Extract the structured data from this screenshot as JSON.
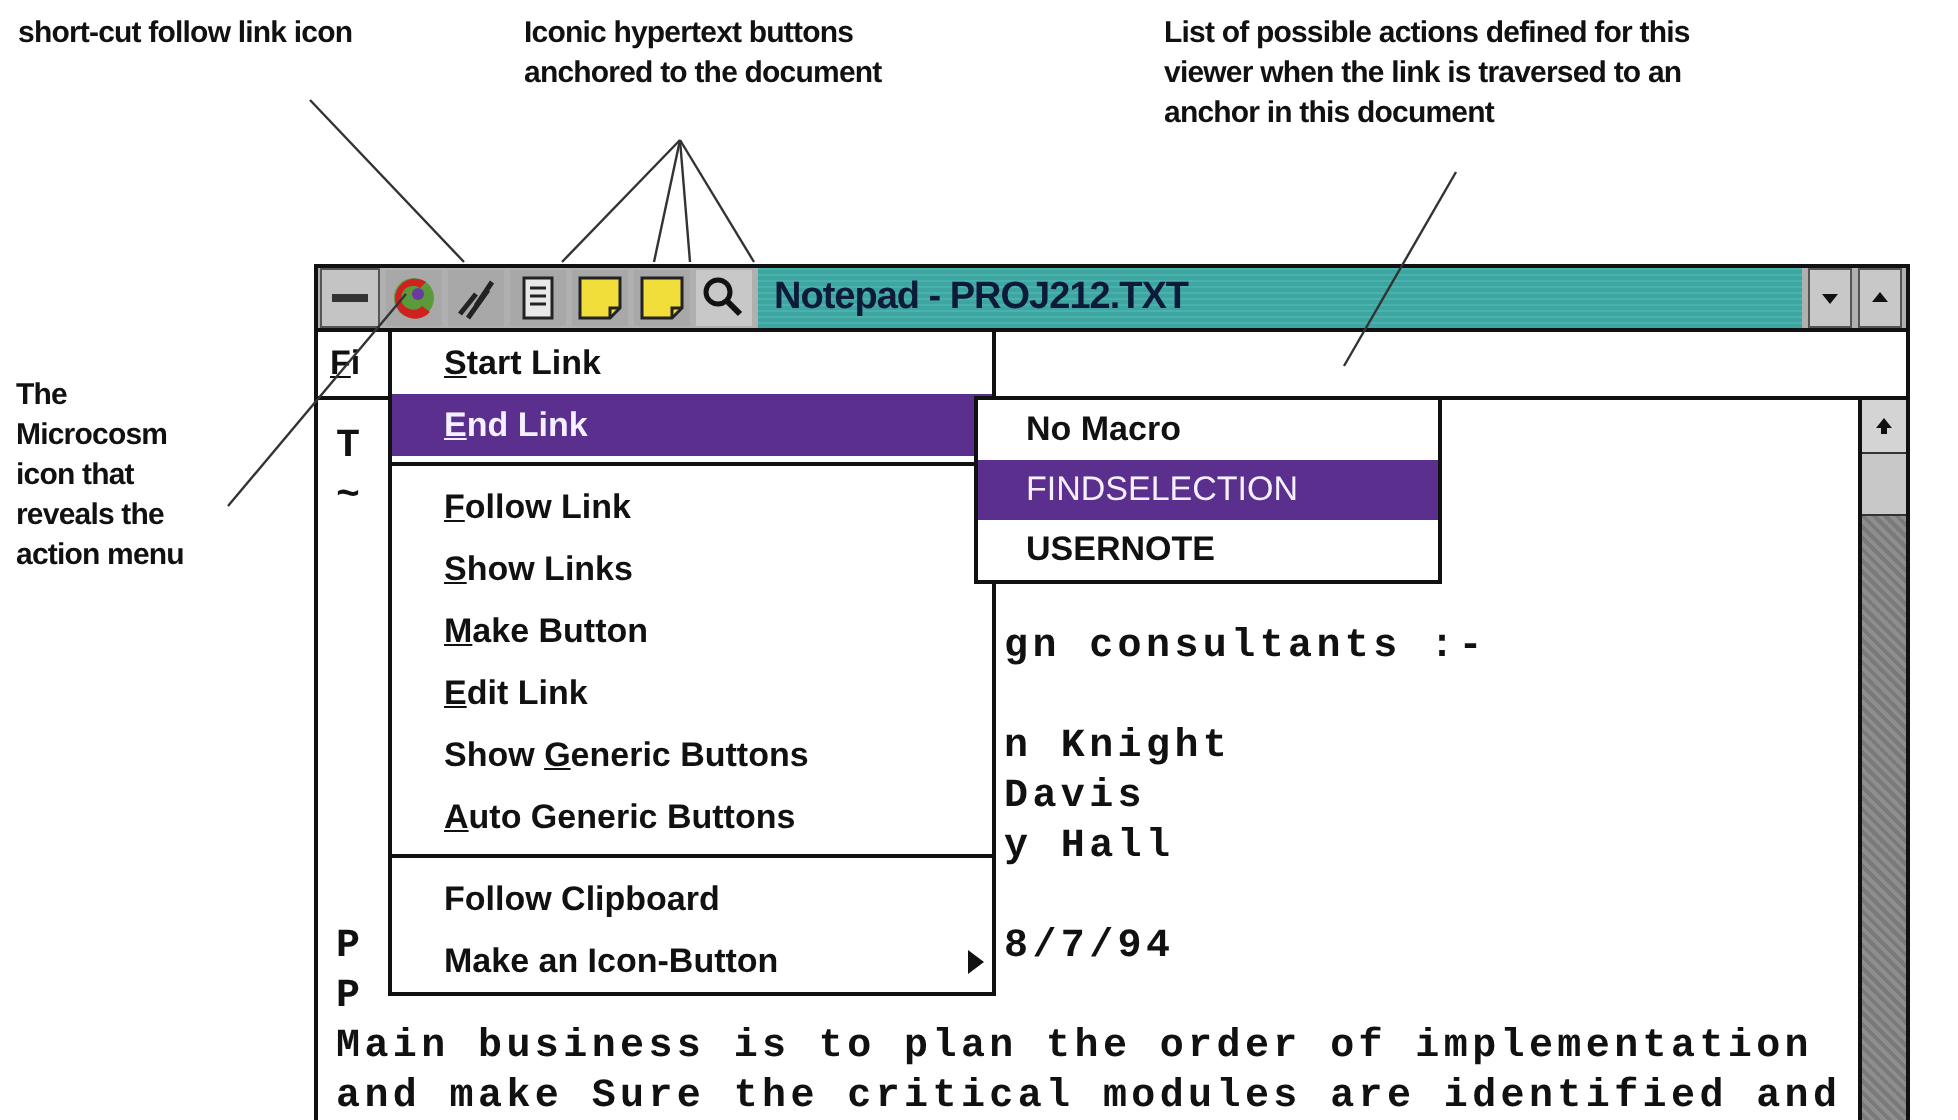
{
  "annotations": [
    {
      "kind": "top-left",
      "lines": [
        "short-cut follow link icon"
      ]
    },
    {
      "kind": "top-middle",
      "lines": [
        "Iconic hypertext buttons",
        "anchored to the document"
      ]
    },
    {
      "kind": "top-right",
      "lines": [
        "List of possible actions defined for this",
        "viewer when the link is traversed to an",
        "anchor in this document"
      ]
    },
    {
      "kind": "left",
      "lines": [
        "The",
        "Microcosm",
        "icon that",
        "reveals the",
        "action menu"
      ]
    }
  ],
  "window": {
    "title": "Notepad - PROJ212.TXT",
    "menu": [
      "Fi"
    ],
    "action_menu": [
      {
        "kind": "item",
        "key": "S",
        "after": "tart Link",
        "selected": false,
        "submenu": false
      },
      {
        "kind": "item",
        "key": "E",
        "after": "nd Link",
        "selected": true,
        "submenu": false
      },
      {
        "kind": "separator"
      },
      {
        "kind": "item",
        "key": "F",
        "after": "ollow Link",
        "selected": false,
        "submenu": false
      },
      {
        "kind": "item",
        "key": "S",
        "after": "how Links",
        "selected": false,
        "submenu": false
      },
      {
        "kind": "item",
        "key": "M",
        "after": "ake Button",
        "selected": false,
        "submenu": false
      },
      {
        "kind": "item",
        "key": "E",
        "after": "dit Link",
        "selected": false,
        "submenu": false
      },
      {
        "kind": "item",
        "before": "Show ",
        "key": "G",
        "after": "eneric Buttons",
        "selected": false,
        "submenu": false
      },
      {
        "kind": "item",
        "key": "A",
        "after": "uto Generic Buttons",
        "selected": false,
        "submenu": false
      },
      {
        "kind": "separator"
      },
      {
        "kind": "item",
        "after": "Follow Clipboard",
        "selected": false,
        "submenu": false
      },
      {
        "kind": "item",
        "after": "Make an Icon-Button",
        "selected": false,
        "submenu": true
      }
    ],
    "macro_menu": [
      {
        "label": "No Macro",
        "selected": false
      },
      {
        "label": "FINDSELECTION",
        "selected": true
      },
      {
        "label": "USERNOTE",
        "selected": false
      }
    ],
    "document": [
      {
        "kind": "split",
        "left": "T"
      },
      {
        "kind": "split",
        "left": "~"
      },
      {
        "kind": "blank"
      },
      {
        "kind": "blank"
      },
      {
        "kind": "split",
        "right": "gn consultants :-"
      },
      {
        "kind": "blank"
      },
      {
        "kind": "split",
        "right": "n Knight"
      },
      {
        "kind": "split",
        "right": "Davis"
      },
      {
        "kind": "split",
        "right": "y Hall"
      },
      {
        "kind": "blank"
      },
      {
        "kind": "split",
        "left": "P",
        "right": "8/7/94"
      },
      {
        "kind": "split",
        "left": "P"
      },
      {
        "kind": "full",
        "text": "Main business is to plan the order of implementation"
      },
      {
        "kind": "full",
        "text": "and make Sure the critical modules are identified and"
      }
    ]
  }
}
